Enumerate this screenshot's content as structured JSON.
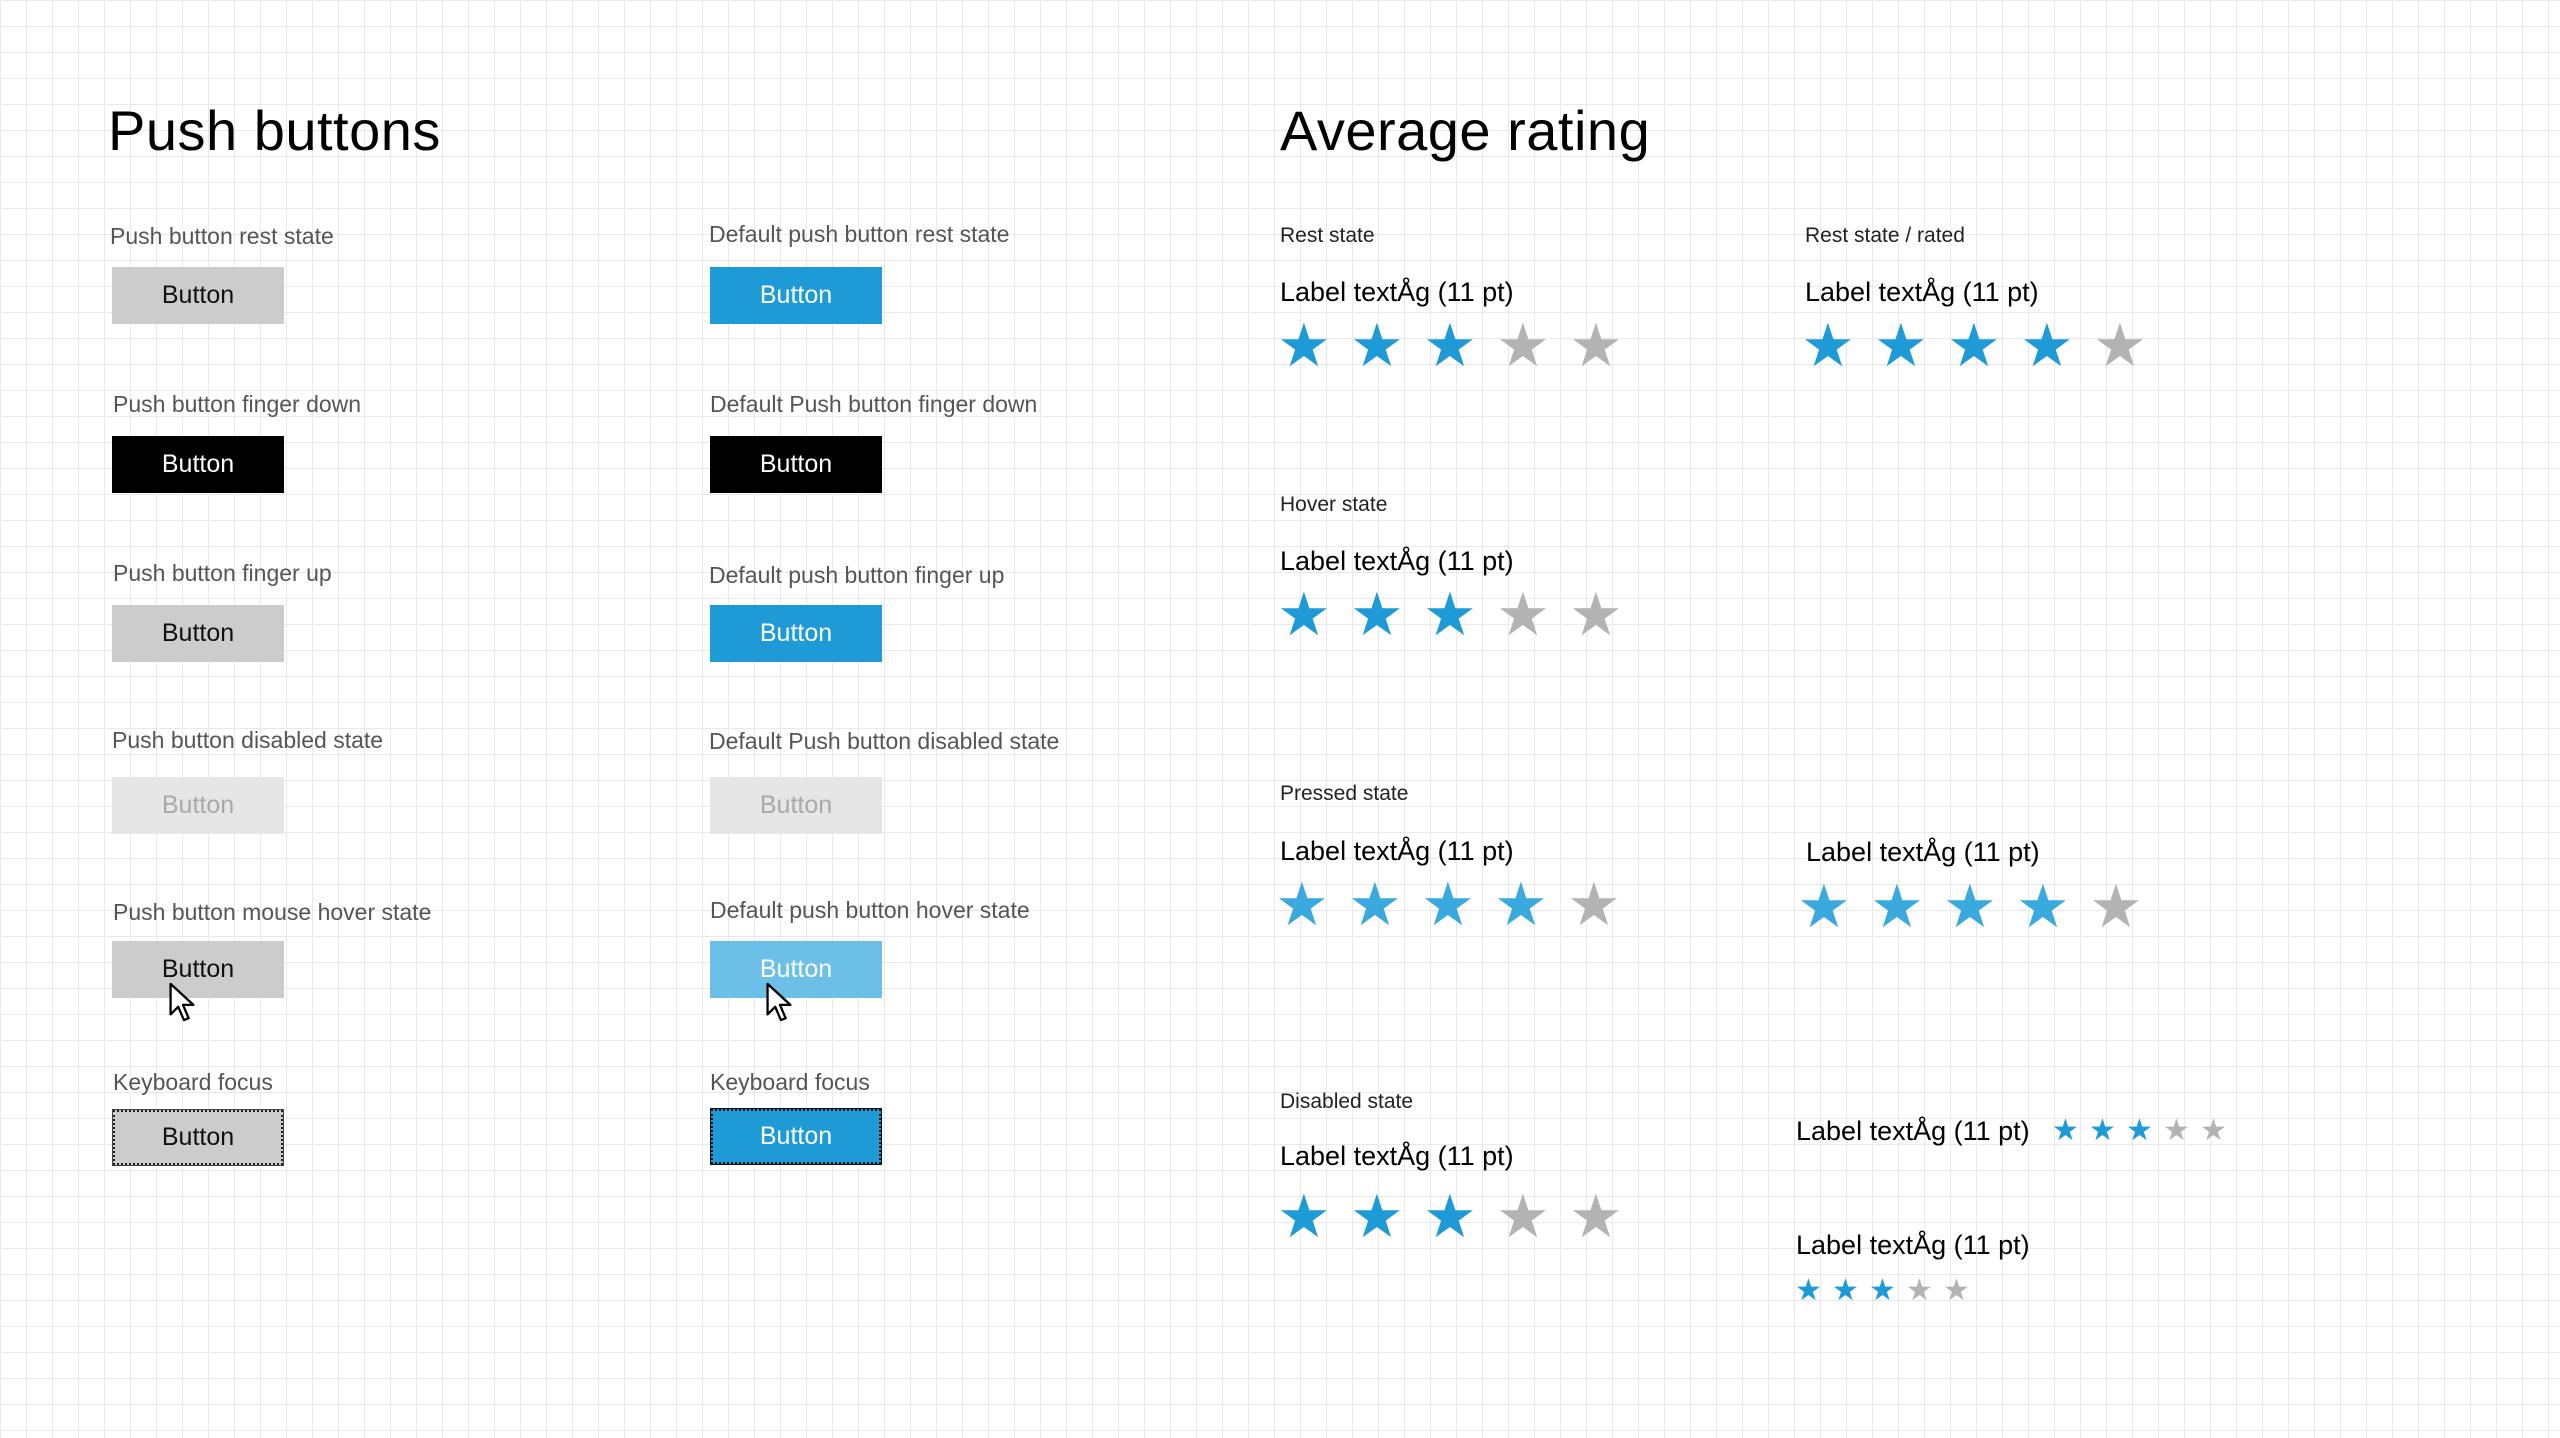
{
  "push_buttons": {
    "title": "Push buttons",
    "rows": [
      {
        "left_caption": "Push button rest state",
        "right_caption": "Default push button rest state"
      },
      {
        "left_caption": "Push button finger down",
        "right_caption": "Default Push button finger down"
      },
      {
        "left_caption": "Push button finger up",
        "right_caption": "Default push button finger up"
      },
      {
        "left_caption": "Push button disabled state",
        "right_caption": "Default Push button disabled state"
      },
      {
        "left_caption": "Push button mouse hover state",
        "right_caption": "Default push button hover state"
      },
      {
        "left_caption": "Keyboard focus",
        "right_caption": "Keyboard focus"
      }
    ],
    "button_label": "Button"
  },
  "average_rating": {
    "title": "Average rating",
    "label_text": "Label textÅg (11 pt)",
    "rest": {
      "caption": "Rest state",
      "rating": 3,
      "max": 5
    },
    "rest_rated": {
      "caption": "Rest state / rated",
      "rating": 4,
      "max": 5
    },
    "hover": {
      "caption": "Hover state",
      "rating": 3,
      "max": 5
    },
    "pressed": {
      "caption": "Pressed state",
      "rating": 4,
      "max": 5
    },
    "pressed_rated": {
      "rating": 4,
      "max": 5
    },
    "disabled": {
      "caption": "Disabled state",
      "rating": 3,
      "max": 5
    },
    "disabled_inline": {
      "rating": 3,
      "max": 5
    },
    "disabled_stacked": {
      "rating": 3,
      "max": 5
    }
  },
  "colors": {
    "accent": "#1e9bd7",
    "star_off": "#b3b3b3",
    "button_gray": "#cccccc"
  },
  "icons": {
    "star": "star-icon",
    "cursor": "mouse-pointer-icon"
  }
}
